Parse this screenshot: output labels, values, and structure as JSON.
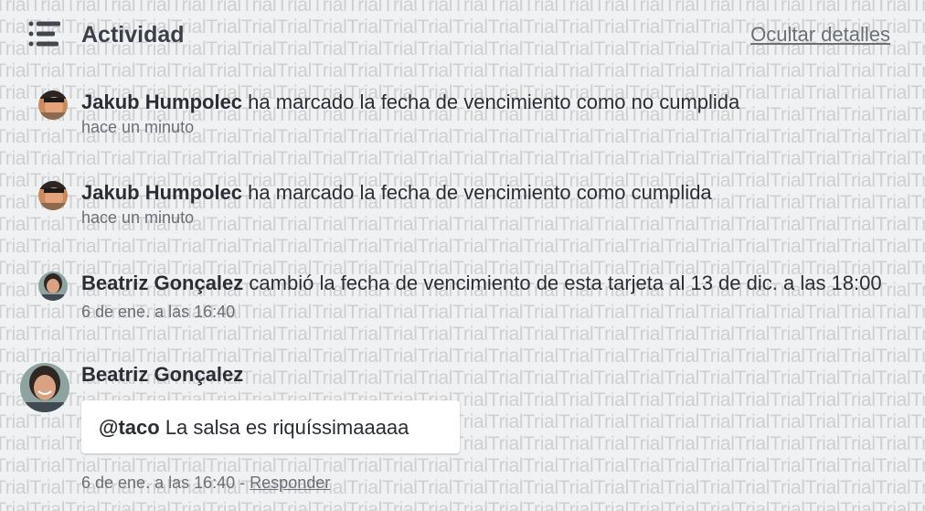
{
  "watermark": {
    "text": "Trial"
  },
  "header": {
    "title": "Actividad",
    "hide_details": "Ocultar detalles"
  },
  "activities": [
    {
      "author": "Jakub Humpolec",
      "action": "ha marcado la fecha de vencimiento como no cumplida",
      "time": "hace un minuto"
    },
    {
      "author": "Jakub Humpolec",
      "action": "ha marcado la fecha de vencimiento como cumplida",
      "time": "hace un minuto"
    },
    {
      "author": "Beatriz Gonçalez",
      "action": "cambió la fecha de vencimiento de esta tarjeta al 13 de dic. a las 18:00",
      "time": "6 de ene. a las 16:40"
    }
  ],
  "comment": {
    "author": "Beatriz Gonçalez",
    "mention": "@taco",
    "text": "La salsa es riquíssimaaaaa",
    "time": "6 de ene. a las 16:40",
    "separator": "-",
    "reply_label": "Responder"
  },
  "colors": {
    "background": "#f0f1f3",
    "text": "#2a2d33",
    "muted": "#6b6f76"
  },
  "icons": {
    "header": "activity-list-icon"
  }
}
